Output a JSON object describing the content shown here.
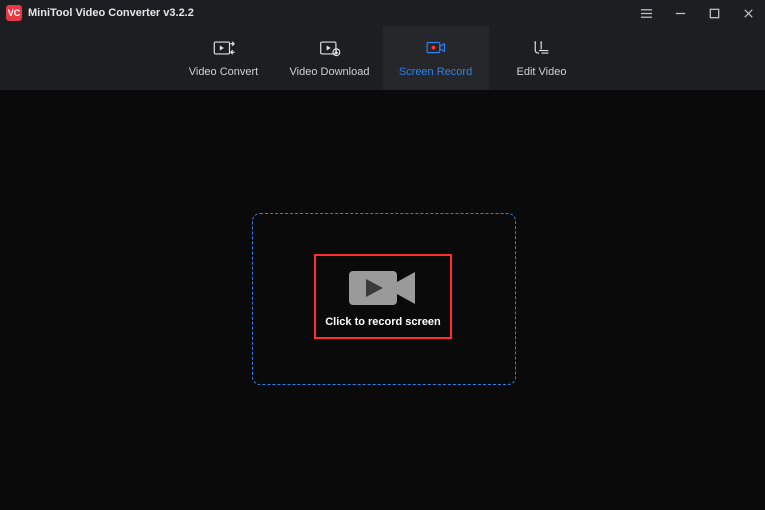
{
  "app": {
    "title": "MiniTool Video Converter v3.2.2",
    "logo_text": "VC"
  },
  "window_controls": {
    "menu": "menu",
    "minimize": "minimize",
    "maximize": "maximize",
    "close": "close"
  },
  "tabs": [
    {
      "id": "convert",
      "label": "Video Convert",
      "icon": "convert-icon",
      "active": false
    },
    {
      "id": "download",
      "label": "Video Download",
      "icon": "download-icon",
      "active": false
    },
    {
      "id": "record",
      "label": "Screen Record",
      "icon": "record-icon",
      "active": true
    },
    {
      "id": "edit",
      "label": "Edit Video",
      "icon": "edit-icon",
      "active": false
    }
  ],
  "main": {
    "record_button_label": "Click to record screen"
  },
  "colors": {
    "accent_blue": "#2f80ed",
    "highlight_red": "#ff2d2d",
    "bg_dark": "#0a0a0b",
    "bg_panel": "#1d1e21"
  }
}
